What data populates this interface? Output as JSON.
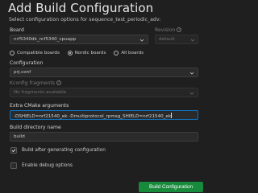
{
  "header": {
    "title": "Add Build Configuration",
    "subtitle": "Select configuration options for sequence_test_periodic_adv:"
  },
  "board": {
    "label": "Board",
    "value": "nrf5340dk_nrf5340_cpuapp",
    "options": [
      {
        "label": "Compatible boards",
        "selected": false
      },
      {
        "label": "Nordic boards",
        "selected": true
      },
      {
        "label": "All boards",
        "selected": false
      }
    ]
  },
  "revision": {
    "label": "Revision",
    "value": "default"
  },
  "configuration": {
    "label": "Configuration",
    "value": "prj.conf"
  },
  "kconfig_fragments": {
    "label": "Kconfig fragments",
    "placeholder": "No fragments available"
  },
  "cmake": {
    "label": "Extra CMake arguments",
    "value": "-DSHIELD=nrf21540_ek -Dmultiprotocol_rpmsg_SHIELD=nrf21540_ek"
  },
  "build_dir": {
    "label": "Build directory name",
    "value": "build"
  },
  "checkboxes": [
    {
      "label": "Build after generating configuration",
      "checked": true
    },
    {
      "label": "Enable debug options",
      "checked": false
    }
  ],
  "actions": {
    "build_label": "Build Configuration"
  },
  "colors": {
    "accent_focus": "#0e73c4",
    "primary_button": "#178a3c",
    "background": "#1f1f1f"
  }
}
